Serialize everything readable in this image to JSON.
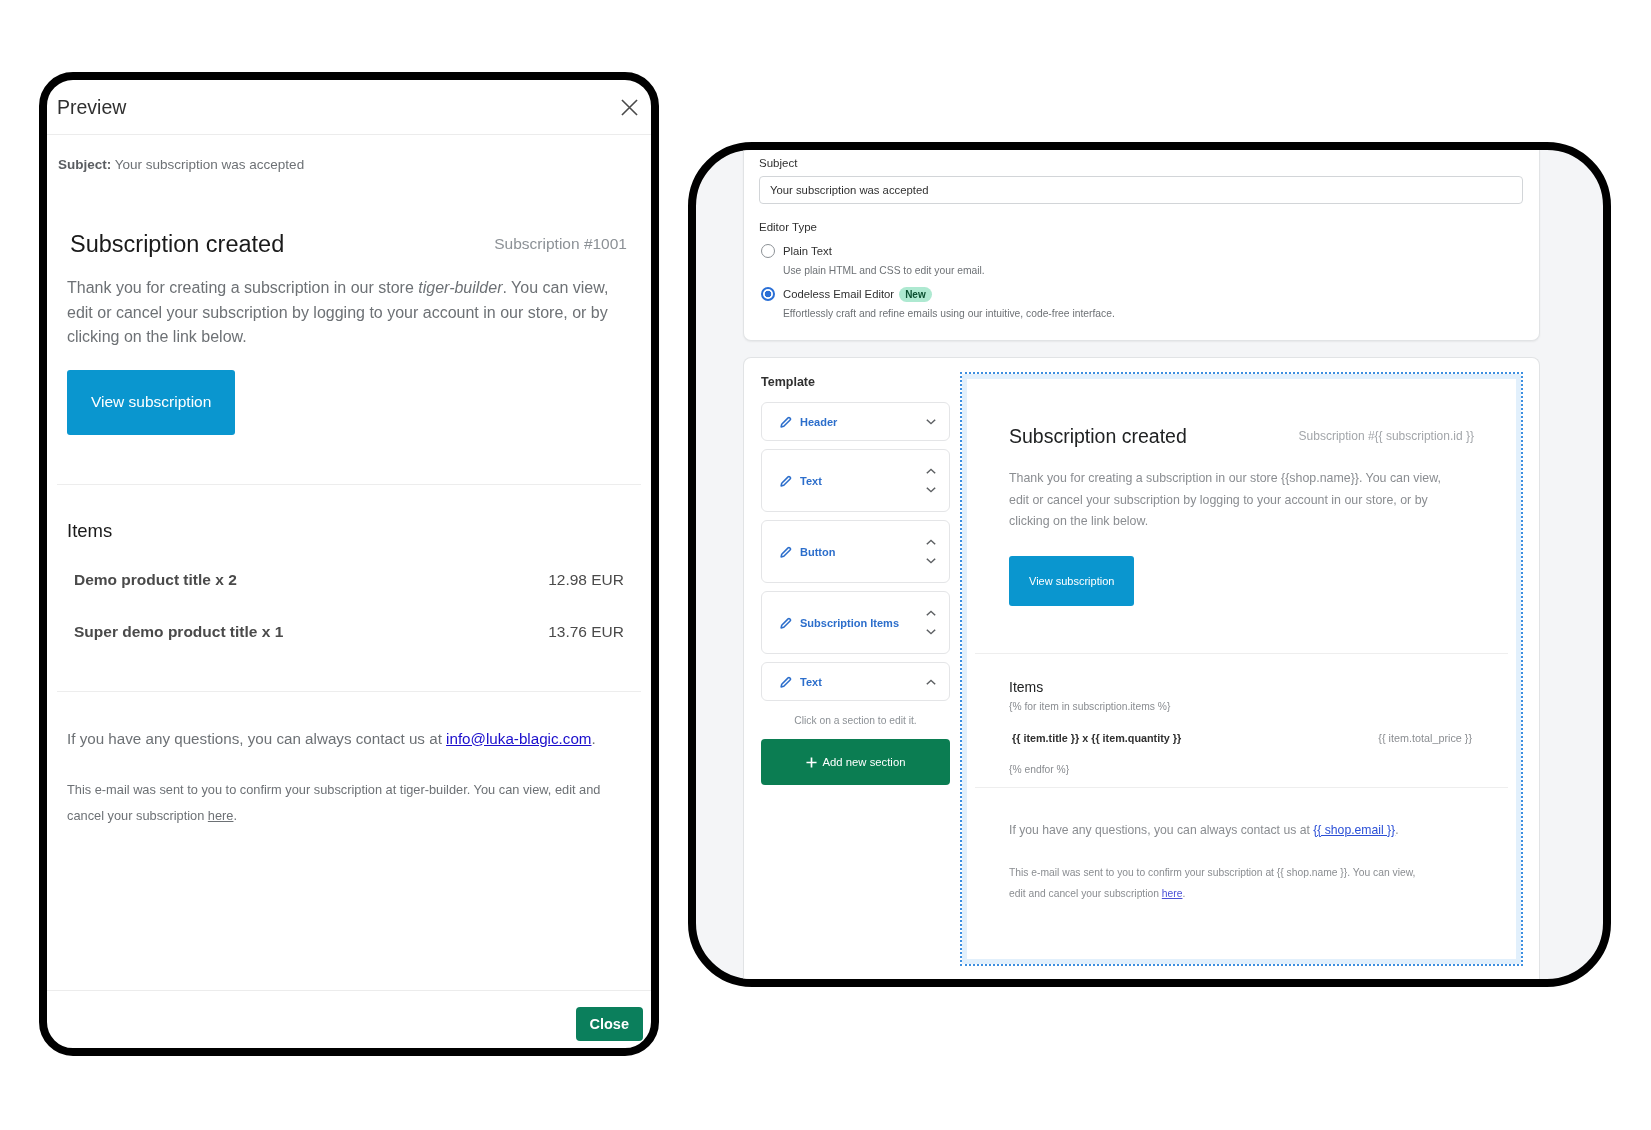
{
  "preview_dialog": {
    "title": "Preview",
    "subject_line": "**Subject:** Your subscription was accepted",
    "email": {
      "heading": "Subscription created",
      "subscription_number": "Subscription #1001",
      "intro": "Thank you for creating a subscription in our store *tiger-builder*. You can view, edit or cancel your subscription by logging to your account in our store, or by clicking on the link below.",
      "button": "View subscription",
      "items_heading": "Items",
      "items": [
        {
          "title": "Demo product title x 2",
          "price": "12.98 EUR"
        },
        {
          "title": "Super demo product title x 1",
          "price": "13.76 EUR"
        }
      ],
      "contact": {
        "text": "If you have any questions, you can always contact us at",
        "link": "info@luka-blagic.com",
        "after": "."
      },
      "footer_note": {
        "text": "This e-mail was sent to you to confirm your subscription at tiger-builder. You can view, edit and cancel your subscription",
        "link": "here",
        "after": "."
      }
    },
    "close_button": "Close"
  },
  "editor": {
    "subject": {
      "label": "Subject",
      "value": "Your subscription was accepted"
    },
    "editor_type": {
      "label": "Editor Type",
      "options": [
        {
          "label": "Plain Text",
          "description": "Use plain HTML and CSS to edit your email.",
          "selected": false
        },
        {
          "label": "Codeless Email Editor",
          "badge": "New",
          "description": "Effortlessly craft and refine emails using our intuitive, code-free interface.",
          "selected": true
        }
      ]
    },
    "template": {
      "label": "Template",
      "sections": [
        {
          "label": "Header",
          "can_move_up": false,
          "can_move_down": true
        },
        {
          "label": "Text",
          "can_move_up": true,
          "can_move_down": true
        },
        {
          "label": "Button",
          "can_move_up": true,
          "can_move_down": true
        },
        {
          "label": "Subscription Items",
          "can_move_up": true,
          "can_move_down": true
        },
        {
          "label": "Text",
          "can_move_up": true,
          "can_move_down": false
        }
      ],
      "hint": "Click on a section to edit it.",
      "add_button": "Add new section"
    },
    "canvas": {
      "heading": "Subscription created",
      "subscription_number": "Subscription #{{ subscription.id }}",
      "intro": "Thank you for creating a subscription in our store {{shop.name}}. You can view, edit or cancel your subscription by logging to your account in our store, or by clicking on the link below.",
      "button": "View subscription",
      "items_heading": "Items",
      "loop_start": "{% for item in subscription.items %}",
      "items": [
        {
          "title": "{{ item.title }} x {{ item.quantity }}",
          "price": "{{ item.total_price }}"
        }
      ],
      "loop_end": "{% endfor %}",
      "contact": {
        "text": "If you have any questions, you can always contact us at",
        "link": "{{ shop.email }}",
        "after": "."
      },
      "footer_note": {
        "text": "This e-mail was sent to you to confirm your subscription at {{ shop.name }}. You can view, edit and cancel your subscription",
        "link": "here",
        "after": "."
      }
    }
  }
}
